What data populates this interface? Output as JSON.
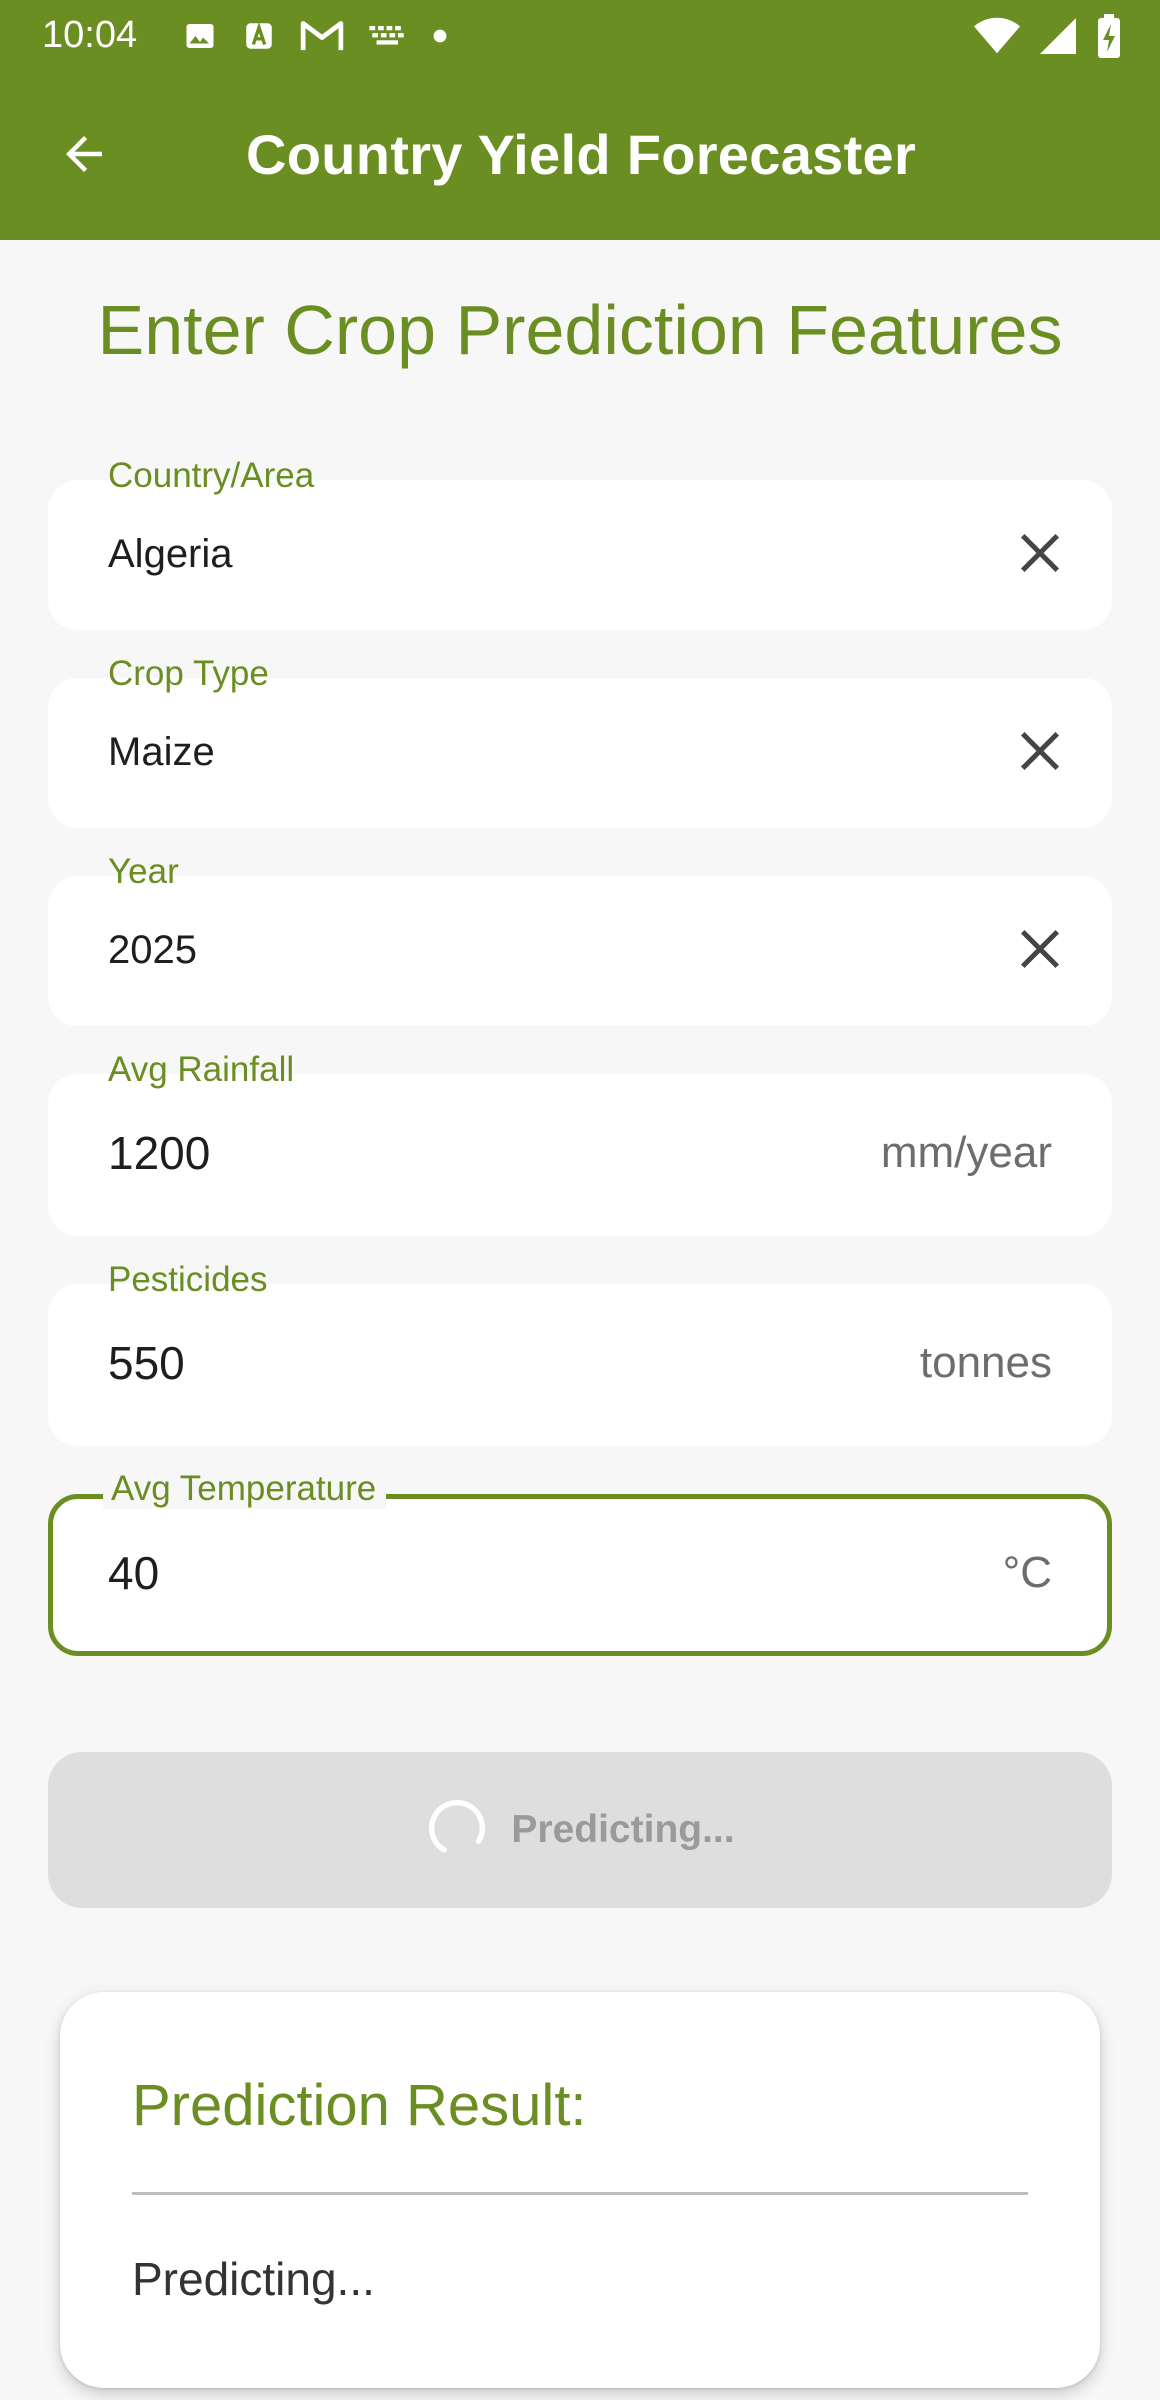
{
  "status_bar": {
    "time": "10:04",
    "left_icons": [
      "image-icon",
      "a-icon",
      "gmail-icon",
      "keyboard-icon",
      "dot-icon"
    ],
    "right_icons": [
      "wifi-icon",
      "signal-icon",
      "battery-icon"
    ]
  },
  "app_bar": {
    "title": "Country Yield Forecaster",
    "back_icon": "arrow-back-icon"
  },
  "heading": "Enter Crop Prediction Features",
  "fields": {
    "country": {
      "label": "Country/Area",
      "value": "Algeria"
    },
    "crop": {
      "label": "Crop Type",
      "value": "Maize"
    },
    "year": {
      "label": "Year",
      "value": "2025"
    },
    "rainfall": {
      "label": "Avg Rainfall",
      "value": "1200",
      "suffix": "mm/year"
    },
    "pesticides": {
      "label": "Pesticides",
      "value": "550",
      "suffix": "tonnes"
    },
    "temperature": {
      "label": "Avg Temperature",
      "value": "40",
      "suffix": "°C"
    }
  },
  "predict_button": {
    "label": "Predicting..."
  },
  "result": {
    "title": "Prediction Result:",
    "text": "Predicting..."
  },
  "colors": {
    "primary": "#6b8e23",
    "background": "#f7f7f7",
    "button_disabled": "#dedede"
  }
}
